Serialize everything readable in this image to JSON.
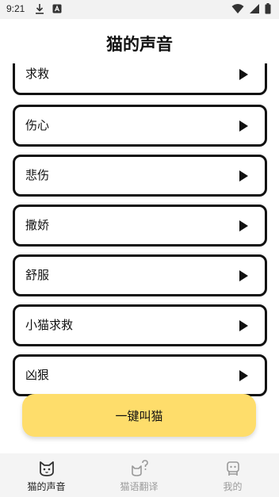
{
  "status": {
    "time": "9:21"
  },
  "page": {
    "title": "猫的声音"
  },
  "sounds": [
    {
      "label": "求救"
    },
    {
      "label": "伤心"
    },
    {
      "label": "悲伤"
    },
    {
      "label": "撒娇"
    },
    {
      "label": "舒服"
    },
    {
      "label": "小猫求救"
    },
    {
      "label": "凶狠"
    }
  ],
  "cta": {
    "label": "一键叫猫"
  },
  "nav": {
    "tabs": [
      {
        "label": "猫的声音",
        "icon": "cat-icon",
        "active": true
      },
      {
        "label": "猫语翻译",
        "icon": "cat-question-icon",
        "active": false
      },
      {
        "label": "我的",
        "icon": "profile-icon",
        "active": false
      }
    ]
  },
  "colors": {
    "accent": "#fedd6b",
    "border": "#111111",
    "nav_bg": "#f4f4f4"
  }
}
